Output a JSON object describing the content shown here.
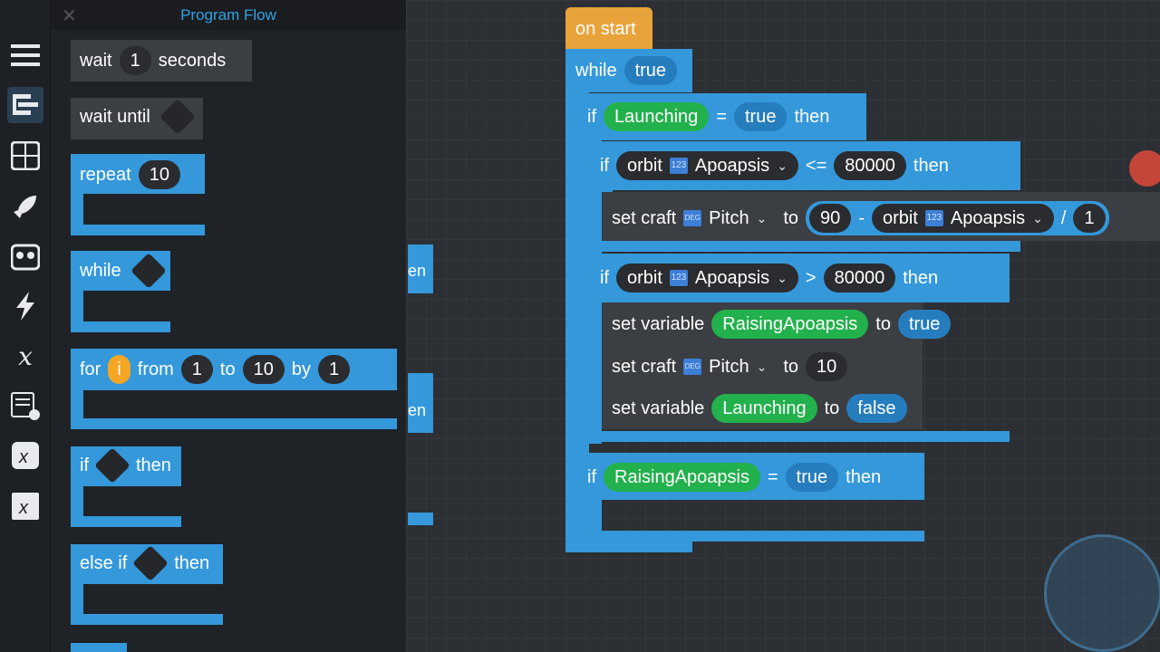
{
  "flyout": {
    "title": "Program Flow",
    "blocks": {
      "wait": {
        "label": "wait",
        "value": "1",
        "suffix": "seconds"
      },
      "wait_until": {
        "label": "wait until"
      },
      "repeat": {
        "label": "repeat",
        "value": "10"
      },
      "while": {
        "label": "while"
      },
      "for": {
        "label": "for",
        "var": "i",
        "from": "from",
        "from_val": "1",
        "to": "to",
        "to_val": "10",
        "by": "by",
        "by_val": "1"
      },
      "if": {
        "label": "if",
        "then": "then"
      },
      "else_if": {
        "label": "else if",
        "then": "then"
      }
    }
  },
  "workspace": {
    "partial_labels": [
      "en",
      "en"
    ],
    "on_start": "on start",
    "while": {
      "label": "while",
      "value": "true"
    },
    "if1": {
      "label": "if",
      "var": "Launching",
      "op": "=",
      "value": "true",
      "then": "then"
    },
    "if2": {
      "label": "if",
      "object": "orbit",
      "prop": "Apoapsis",
      "op": "<=",
      "value": "80000",
      "then": "then"
    },
    "set_pitch1": {
      "label": "set craft",
      "prop": "Pitch",
      "to": "to",
      "a": "90",
      "minus": "-",
      "object": "orbit",
      "prop2": "Apoapsis",
      "div": "/",
      "trail": "1"
    },
    "if3": {
      "label": "if",
      "object": "orbit",
      "prop": "Apoapsis",
      "op": ">",
      "value": "80000",
      "then": "then"
    },
    "set_var1": {
      "label": "set variable",
      "var": "RaisingApoapsis",
      "to": "to",
      "value": "true"
    },
    "set_pitch2": {
      "label": "set craft",
      "prop": "Pitch",
      "to": "to",
      "value": "10"
    },
    "set_var2": {
      "label": "set variable",
      "var": "Launching",
      "to": "to",
      "value": "false"
    },
    "if4": {
      "label": "if",
      "var": "RaisingApoapsis",
      "op": "=",
      "value": "true",
      "then": "then"
    }
  },
  "badge_small": {
    "deg": "DEG",
    "num": "123"
  },
  "colors": {
    "blue": "#3498db",
    "orange": "#e8a33a",
    "green": "#22b14c",
    "dark": "#3b3e42",
    "accent": "#2ea3e6"
  },
  "toolbar_icons": [
    "menu-icon",
    "program-flow-icon",
    "operators-icon",
    "craft-icon",
    "sensors-icon",
    "events-icon",
    "variables-icon",
    "lists-icon",
    "custom-expression-icon",
    "custom-instruction-icon"
  ]
}
